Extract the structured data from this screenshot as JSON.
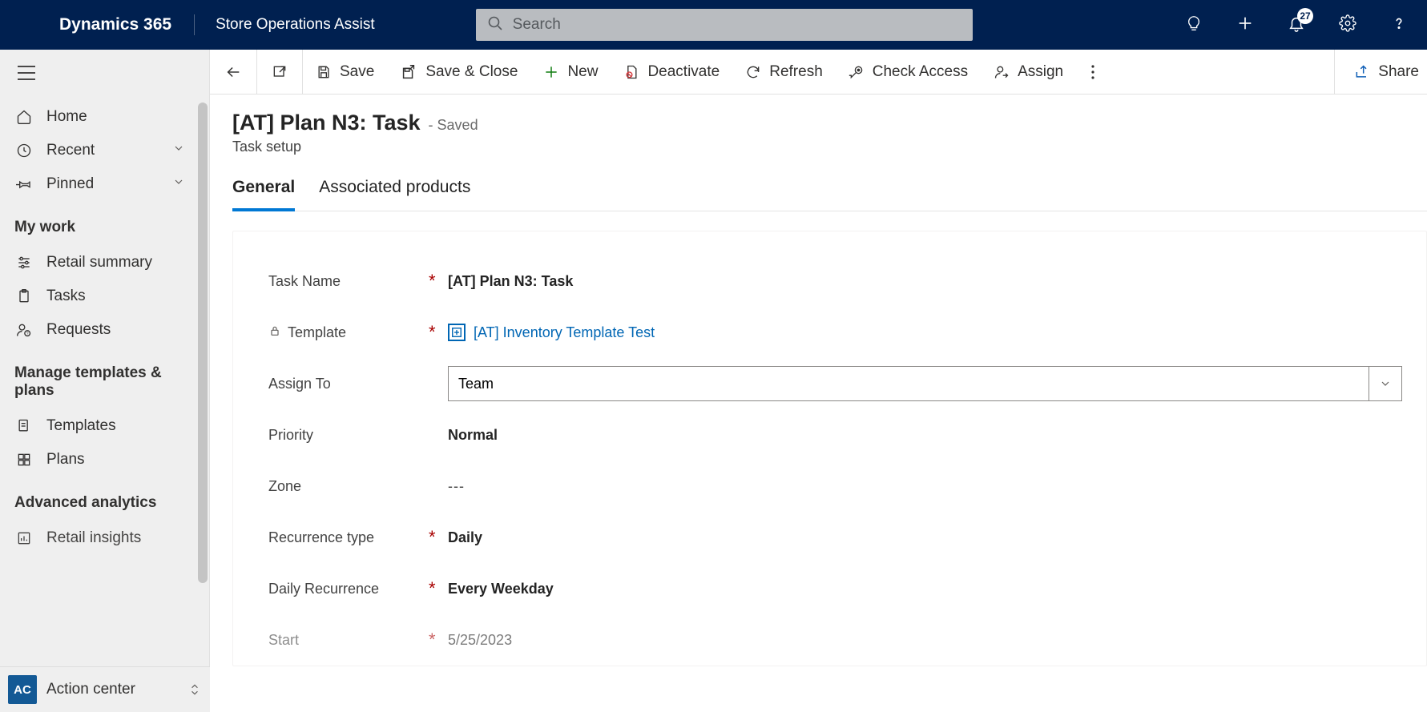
{
  "header": {
    "brand": "Dynamics 365",
    "app_name": "Store Operations Assist",
    "search_placeholder": "Search",
    "notification_count": "27"
  },
  "sidebar": {
    "items_top": [
      {
        "label": "Home"
      },
      {
        "label": "Recent"
      },
      {
        "label": "Pinned"
      }
    ],
    "section_mywork": "My work",
    "items_mywork": [
      {
        "label": "Retail summary"
      },
      {
        "label": "Tasks"
      },
      {
        "label": "Requests"
      }
    ],
    "section_manage": "Manage templates & plans",
    "items_manage": [
      {
        "label": "Templates"
      },
      {
        "label": "Plans"
      }
    ],
    "section_analytics": "Advanced analytics",
    "items_analytics": [
      {
        "label": "Retail insights"
      }
    ],
    "switcher": {
      "badge": "AC",
      "label": "Action center"
    }
  },
  "commandbar": {
    "save": "Save",
    "save_close": "Save & Close",
    "new": "New",
    "deactivate": "Deactivate",
    "refresh": "Refresh",
    "check_access": "Check Access",
    "assign": "Assign",
    "share": "Share"
  },
  "page": {
    "title": "[AT] Plan N3: Task",
    "status": "- Saved",
    "subtitle": "Task setup",
    "tabs": [
      {
        "label": "General",
        "active": true
      },
      {
        "label": "Associated products",
        "active": false
      }
    ]
  },
  "form": {
    "task_name": {
      "label": "Task Name",
      "value": "[AT] Plan N3: Task",
      "required": true
    },
    "template": {
      "label": "Template",
      "value": "[AT] Inventory Template Test",
      "required": true,
      "locked": true
    },
    "assign_to": {
      "label": "Assign To",
      "value": "Team"
    },
    "priority": {
      "label": "Priority",
      "value": "Normal"
    },
    "zone": {
      "label": "Zone",
      "value": "---"
    },
    "recurrence_type": {
      "label": "Recurrence type",
      "value": "Daily",
      "required": true
    },
    "daily_recurrence": {
      "label": "Daily Recurrence",
      "value": "Every Weekday",
      "required": true
    },
    "start": {
      "label": "Start",
      "value": "5/25/2023",
      "required": true
    }
  }
}
